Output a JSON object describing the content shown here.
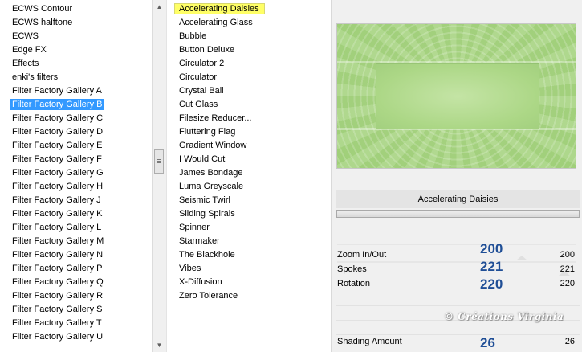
{
  "categories": {
    "items": [
      "ECWS Contour",
      "ECWS halftone",
      "ECWS",
      "Edge FX",
      "Effects",
      "enki's filters",
      "Filter Factory Gallery A",
      "Filter Factory Gallery B",
      "Filter Factory Gallery C",
      "Filter Factory Gallery D",
      "Filter Factory Gallery E",
      "Filter Factory Gallery F",
      "Filter Factory Gallery G",
      "Filter Factory Gallery H",
      "Filter Factory Gallery J",
      "Filter Factory Gallery K",
      "Filter Factory Gallery L",
      "Filter Factory Gallery M",
      "Filter Factory Gallery N",
      "Filter Factory Gallery P",
      "Filter Factory Gallery Q",
      "Filter Factory Gallery R",
      "Filter Factory Gallery S",
      "Filter Factory Gallery T",
      "Filter Factory Gallery U"
    ],
    "selected": "Filter Factory Gallery B"
  },
  "filters": {
    "items": [
      "Accelerating Daisies",
      "Accelerating Glass",
      "Bubble",
      "Button Deluxe",
      "Circulator 2",
      "Circulator",
      "Crystal Ball",
      "Cut Glass",
      "Filesize Reducer...",
      "Fluttering Flag",
      "Gradient Window",
      "I Would Cut",
      "James Bondage",
      "Luma Greyscale",
      "Seismic Twirl",
      "Sliding Spirals",
      "Spinner",
      "Starmaker",
      "The Blackhole",
      "Vibes",
      "X-Diffusion",
      "Zero Tolerance"
    ],
    "selected": "Accelerating Daisies"
  },
  "preview": {
    "filter_name": "Accelerating Daisies",
    "icon": "preview-image",
    "colors": {
      "green": "#a9d584",
      "light_green": "#c4e4a5"
    }
  },
  "params": [
    {
      "name": "Zoom In/Out",
      "value": "200",
      "big_label": "200"
    },
    {
      "name": "Spokes",
      "value": "221",
      "big_label": "221"
    },
    {
      "name": "Rotation",
      "value": "220",
      "big_label": "220"
    },
    {
      "name": "Shading Amount",
      "value": "26",
      "big_label": "26"
    }
  ],
  "watermark": "© Créations Virginia",
  "colors": {
    "selection": "#3399ff",
    "highlight": "#ffff66",
    "annotation": "#1f4e96"
  }
}
